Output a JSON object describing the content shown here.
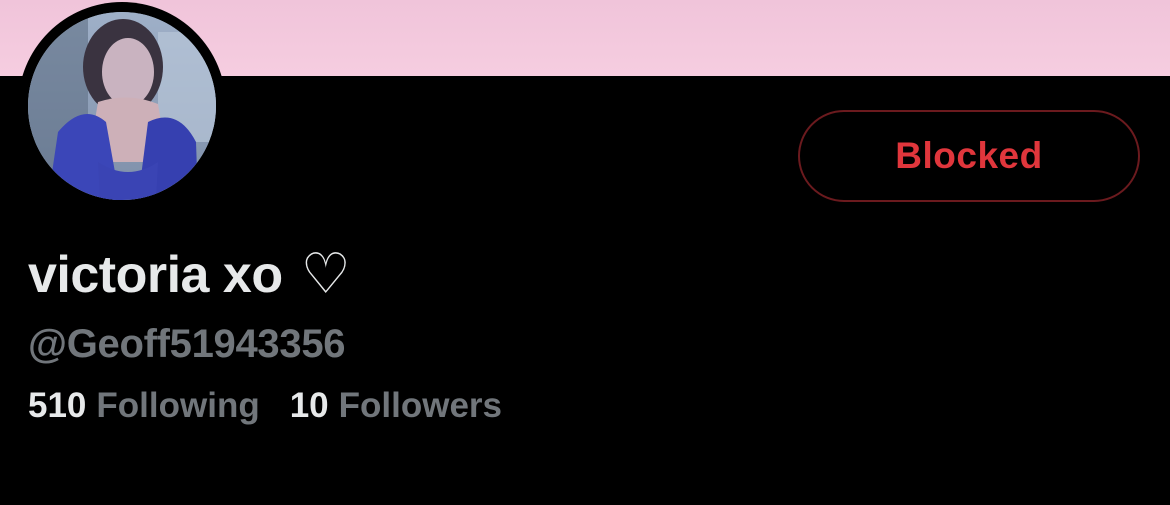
{
  "profile": {
    "display_name": "victoria xo",
    "name_suffix": "♡",
    "handle": "@Geoff51943356",
    "following_count": "510",
    "following_label": "Following",
    "followers_count": "10",
    "followers_label": "Followers"
  },
  "actions": {
    "blocked_label": "Blocked"
  },
  "colors": {
    "banner": "#f6cde0",
    "background": "#000000",
    "blocked_text": "#e0363c",
    "blocked_border": "#6b1a1e",
    "primary_text": "#e7e9ea",
    "secondary_text": "#71767b"
  }
}
